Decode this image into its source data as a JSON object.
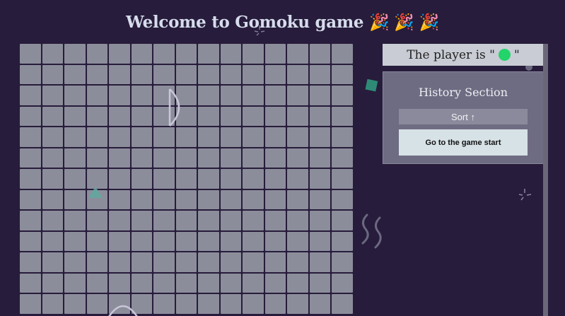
{
  "page": {
    "title": "Welcome to Gomoku game",
    "title_emoji": "🎉 🎉 🎉"
  },
  "board": {
    "columns": 15,
    "visible_rows": 13,
    "cell_color": "#8c8d9b",
    "background_color": "#271c3b"
  },
  "player": {
    "prefix": "The player is \"",
    "suffix": "\"",
    "current_piece_color": "#22d46a",
    "current_piece_icon": "green-circle"
  },
  "history": {
    "title": "History Section",
    "sort_label": "Sort ↑",
    "moves": [
      {
        "label": "Go to the game start"
      }
    ]
  }
}
